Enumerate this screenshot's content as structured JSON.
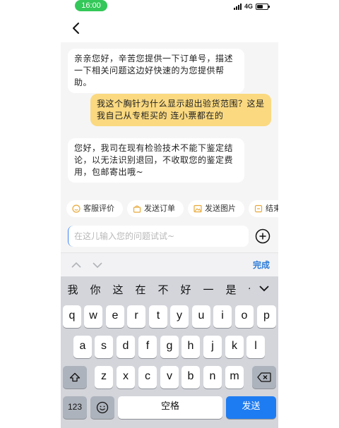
{
  "status_bar": {
    "time": "16:00",
    "network": "4G",
    "signal_bars": 4,
    "battery_level": 0.6
  },
  "nav": {
    "back_icon": "chevron-left-icon"
  },
  "chat": {
    "messages": [
      {
        "side": "left",
        "text": "亲亲您好，辛苦您提供一下订单号，描述一下相关问题这边好快速的为您提供帮助。"
      },
      {
        "side": "right",
        "text": "我这个胸针为什么显示超出验货范围？这是我自己从专柜买的 连小票都在的"
      },
      {
        "side": "left",
        "text": "您好，我司在现有检验技术不能下鉴定结论，以无法识别退回，不收取您的鉴定费用，包邮寄出哦~"
      }
    ]
  },
  "quick_actions": [
    {
      "label": "客服评价",
      "icon": "smiley-icon"
    },
    {
      "label": "发送订单",
      "icon": "bag-icon"
    },
    {
      "label": "发送图片",
      "icon": "image-icon"
    },
    {
      "label": "结束",
      "icon": "end-icon"
    }
  ],
  "input": {
    "placeholder": "在这儿输入您的问题试试~",
    "value": ""
  },
  "keyboard_accessory": {
    "done_label": "完成"
  },
  "candidates": [
    "我",
    "你",
    "这",
    "在",
    "不",
    "好",
    "一",
    "是",
    "今"
  ],
  "keys": {
    "row1": [
      "q",
      "w",
      "e",
      "r",
      "t",
      "y",
      "u",
      "i",
      "o",
      "p"
    ],
    "row2": [
      "a",
      "s",
      "d",
      "f",
      "g",
      "h",
      "j",
      "k",
      "l"
    ],
    "row3": [
      "z",
      "x",
      "c",
      "v",
      "b",
      "n",
      "m"
    ],
    "numbers_label": "123",
    "space_label": "空格",
    "send_label": "发送"
  },
  "colors": {
    "accent": "#1e7cf2",
    "user_bubble": "#fad980",
    "time_pill": "#34c759",
    "done": "#2c7bd8"
  }
}
